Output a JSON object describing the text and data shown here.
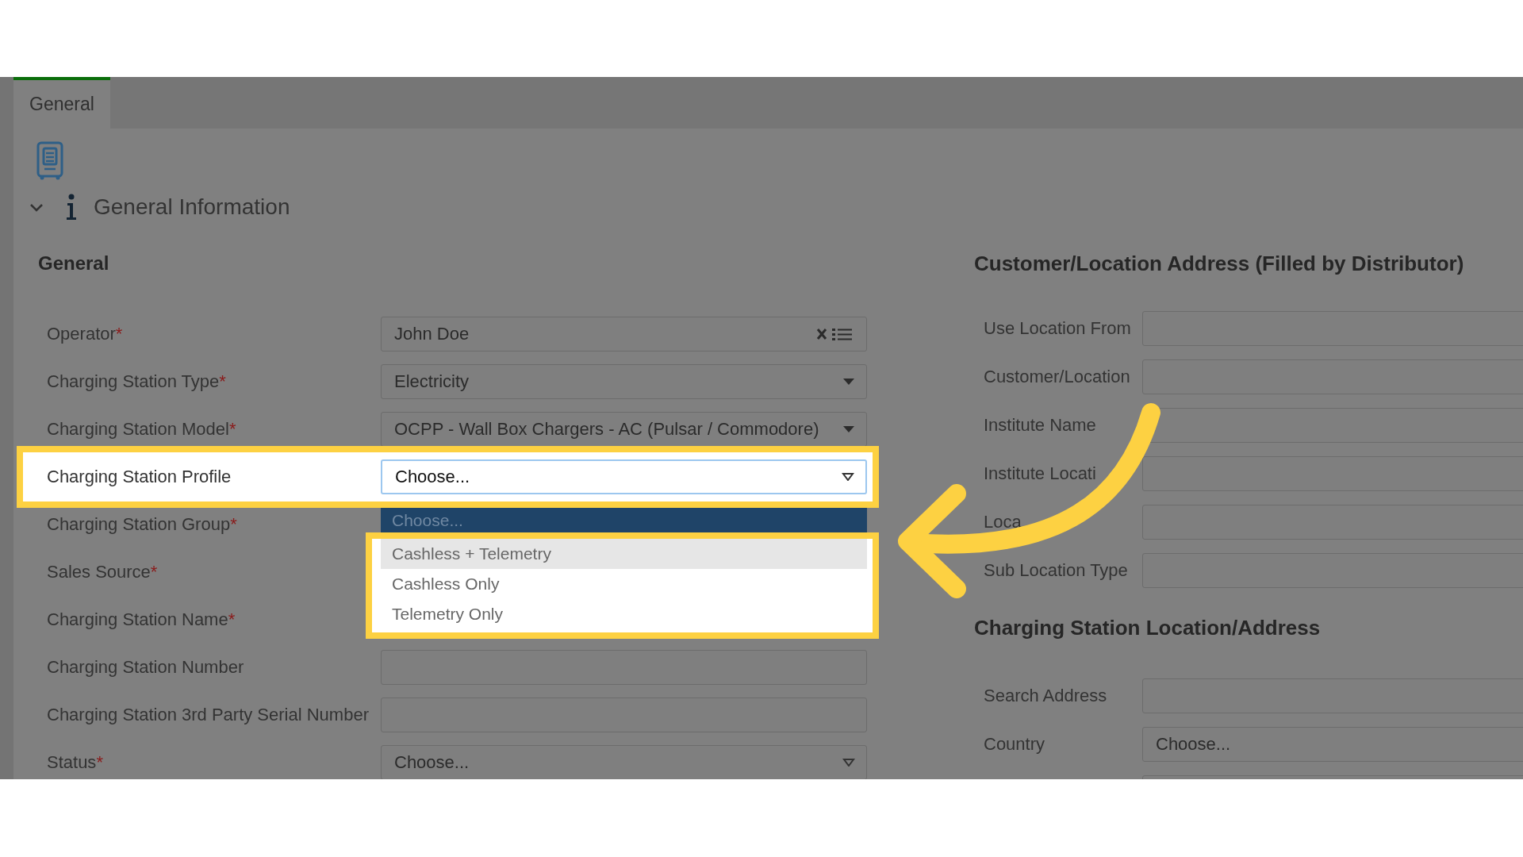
{
  "tabs": [
    {
      "label": "General",
      "selected": true
    }
  ],
  "section": {
    "title": "General Information",
    "expanded": true
  },
  "left": {
    "heading": "General",
    "fields": [
      {
        "label": "Operator",
        "required_mark": "*",
        "kind": "lookup",
        "value": "John Doe"
      },
      {
        "label": "Charging Station Type",
        "required_mark": "*",
        "kind": "select",
        "value": "Electricity"
      },
      {
        "label": "Charging Station Model",
        "required_mark": "*",
        "kind": "select",
        "value": "OCPP - Wall Box Chargers - AC (Pulsar / Commodore)"
      },
      {
        "label": "Charging Station Profile",
        "kind": "select",
        "placeholder": "Choose...",
        "highlighted": true,
        "open": true,
        "options": [
          {
            "label": "Choose...",
            "selected": true,
            "hovered": false
          },
          {
            "label": "Cashless + Telemetry",
            "selected": false,
            "hovered": true
          },
          {
            "label": "Cashless Only",
            "selected": false,
            "hovered": false
          },
          {
            "label": "Telemetry Only",
            "selected": false,
            "hovered": false
          }
        ]
      },
      {
        "label": "Charging Station Group",
        "required_mark": "*"
      },
      {
        "label": "Sales Source",
        "required_mark": "*"
      },
      {
        "label": "Charging Station Name",
        "required_mark": "*"
      },
      {
        "label": "Charging Station Number",
        "kind": "text"
      },
      {
        "label": "Charging Station 3rd Party Serial Number",
        "kind": "text"
      },
      {
        "label": "Status",
        "required_mark": "*",
        "kind": "select",
        "placeholder": "Choose..."
      }
    ]
  },
  "right": {
    "groups": [
      {
        "heading": "Customer/Location Address (Filled by Distributor)",
        "fields": [
          {
            "label": "Use Location From",
            "kind": "text"
          },
          {
            "label": "Customer/Location",
            "kind": "text"
          },
          {
            "label": "Institute Name",
            "kind": "text"
          },
          {
            "label": "Institute Locati",
            "kind": "text"
          },
          {
            "label": "Loca",
            "kind": "text"
          },
          {
            "label": "Sub Location Type",
            "kind": "text"
          }
        ]
      },
      {
        "heading": "Charging Station Location/Address",
        "fields": [
          {
            "label": "Search Address",
            "kind": "text"
          },
          {
            "label": "Country",
            "kind": "text",
            "placeholder": "Choose..."
          },
          {
            "kind": "text"
          }
        ]
      }
    ]
  }
}
